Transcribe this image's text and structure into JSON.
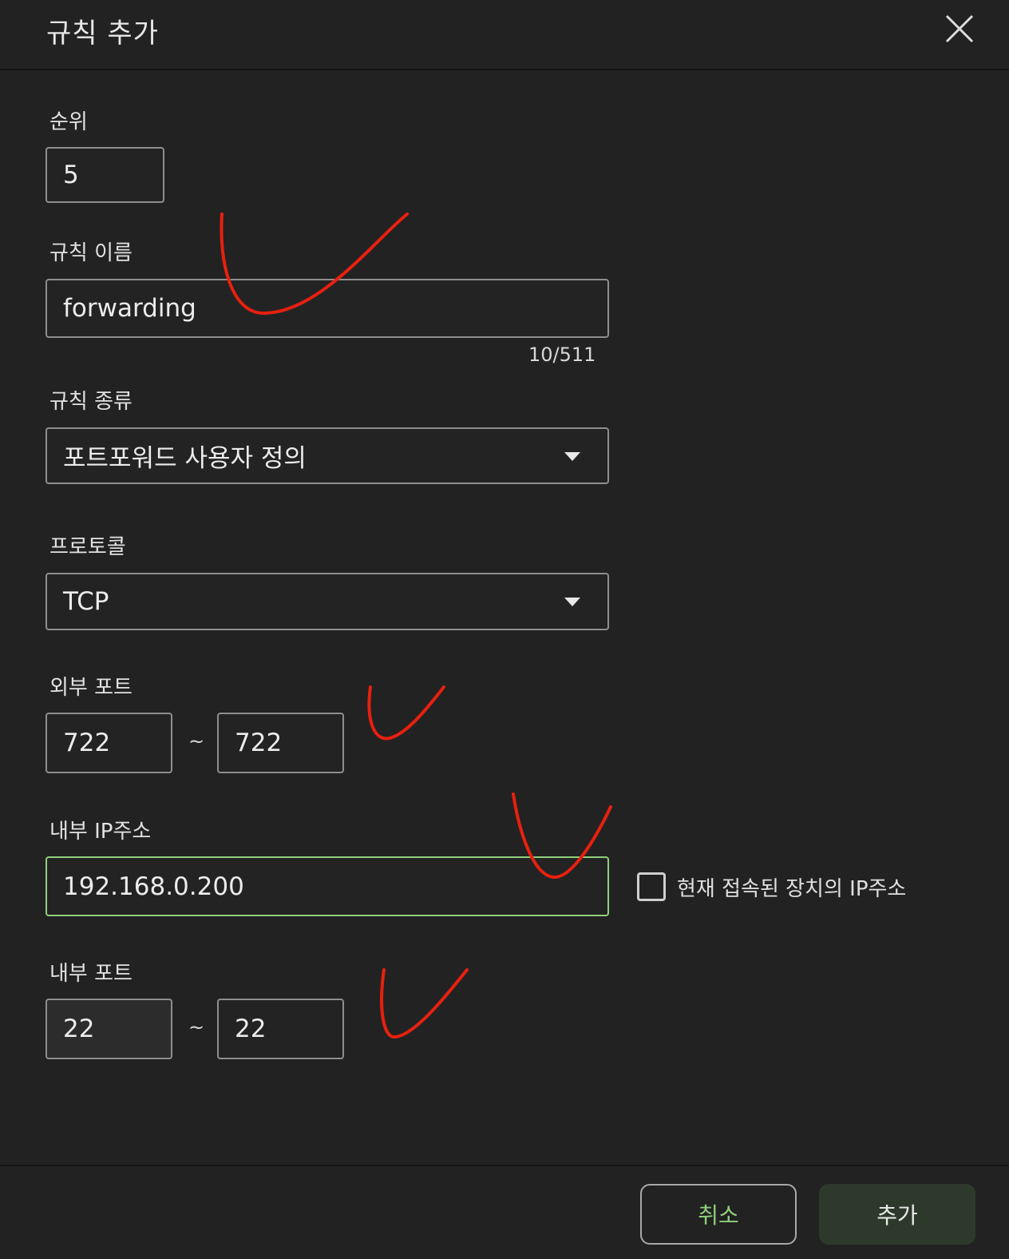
{
  "dialog": {
    "title": "규칙 추가",
    "close_icon": "close-icon"
  },
  "fields": {
    "order": {
      "label": "순위",
      "value": "5"
    },
    "rule_name": {
      "label": "규칙 이름",
      "value": "forwarding",
      "counter": "10/511"
    },
    "rule_type": {
      "label": "규칙 종류",
      "value": "포트포워드 사용자 정의",
      "icon": "chevron-down-icon"
    },
    "protocol": {
      "label": "프로토콜",
      "value": "TCP",
      "icon": "chevron-down-icon"
    },
    "external_port": {
      "label": "외부 포트",
      "from": "722",
      "separator": "~",
      "to": "722"
    },
    "internal_ip": {
      "label": "내부 IP주소",
      "value": "192.168.0.200"
    },
    "use_current_device_ip": {
      "label": "현재 접속된 장치의 IP주소",
      "checked": false
    },
    "internal_port": {
      "label": "내부 포트",
      "from": "22",
      "separator": "~",
      "to": "22"
    }
  },
  "footer": {
    "cancel_label": "취소",
    "add_label": "추가"
  },
  "colors": {
    "background": "#222222",
    "focus_border": "#8fd07a",
    "cancel_text": "#8fd07a",
    "add_button": "#2d3a2b",
    "annotation": "#e8200f"
  }
}
